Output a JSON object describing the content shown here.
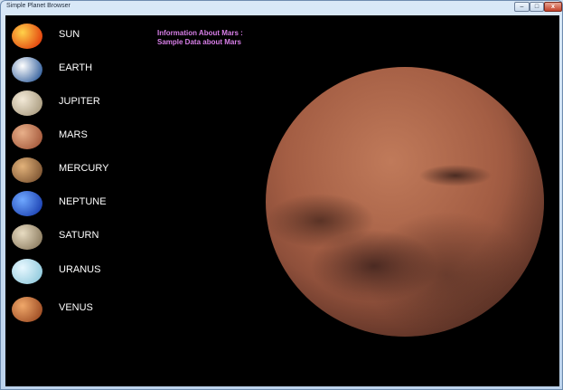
{
  "window": {
    "title": "Simple Planet Browser",
    "minimize": "–",
    "maximize": "□",
    "close": "x"
  },
  "planets": [
    {
      "label": "SUN",
      "icon": "sun-thumbnail-icon",
      "colors": [
        "#ffd24a",
        "#e23b0a"
      ]
    },
    {
      "label": "EARTH",
      "icon": "earth-thumbnail-icon",
      "colors": [
        "#ffffff",
        "#2f5c9a"
      ]
    },
    {
      "label": "JUPITER",
      "icon": "jupiter-thumbnail-icon",
      "colors": [
        "#f3ead8",
        "#a89a7e"
      ]
    },
    {
      "label": "MARS",
      "icon": "mars-thumbnail-icon",
      "colors": [
        "#e8b08a",
        "#a3573a"
      ]
    },
    {
      "label": "MERCURY",
      "icon": "mercury-thumbnail-icon",
      "colors": [
        "#e2b27a",
        "#7a5230"
      ]
    },
    {
      "label": "NEPTUNE",
      "icon": "neptune-thumbnail-icon",
      "colors": [
        "#6fa8ff",
        "#1a3fb0"
      ]
    },
    {
      "label": "SATURN",
      "icon": "saturn-thumbnail-icon",
      "colors": [
        "#e8dcc2",
        "#8a7a5e"
      ]
    },
    {
      "label": "URANUS",
      "icon": "uranus-thumbnail-icon",
      "colors": [
        "#e8f8ff",
        "#8fc9dc"
      ]
    },
    {
      "label": "VENUS",
      "icon": "venus-thumbnail-icon",
      "colors": [
        "#f0a86a",
        "#9b4a22"
      ]
    }
  ],
  "info": {
    "line1": "Information About Mars :",
    "line2": "Sample Data about Mars",
    "color": "#d87fe8"
  },
  "selected_planet_image": "mars-image"
}
